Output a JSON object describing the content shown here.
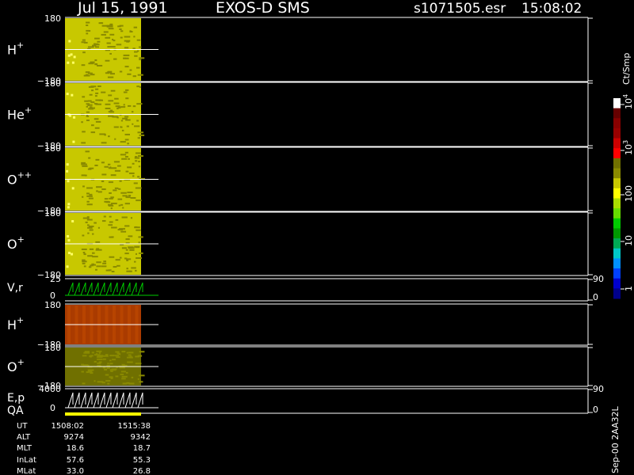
{
  "header": {
    "date": "Jul 15, 1991",
    "instrument": "EXOS-D SMS",
    "file": "s1071505.esr",
    "time": "15:08:02"
  },
  "panels": [
    {
      "id": "h-plus",
      "label": "H",
      "sup": "+",
      "ymax": "180",
      "ymin": "−180",
      "color": "#c8c800"
    },
    {
      "id": "he-plus",
      "label": "He",
      "sup": "+",
      "ymax": "180",
      "ymin": "−180",
      "color": "#c8c800"
    },
    {
      "id": "o-plus-plus",
      "label": "O",
      "sup": "++",
      "ymax": "180",
      "ymin": "−180",
      "color": "#c8c800"
    },
    {
      "id": "o-plus",
      "label": "O",
      "sup": "+",
      "ymax": "180",
      "ymin": "−180",
      "color": "#c8c800"
    },
    {
      "id": "vr",
      "label": "V,r",
      "sup": "",
      "ymax": "25",
      "ymin": "0",
      "rmax": "90",
      "rmin": "0",
      "color": "#00cc00"
    },
    {
      "id": "h-plus-2",
      "label": "H",
      "sup": "+",
      "ymax": "180",
      "ymin": "−180",
      "color": "#cc2200"
    },
    {
      "id": "o-plus-2",
      "label": "O",
      "sup": "+",
      "ymax": "180",
      "ymin": "−180",
      "color": "#707000"
    },
    {
      "id": "ep-qa",
      "label": "E,p",
      "label2": "QA",
      "sup": "",
      "ymax": "4000",
      "ymin": "0",
      "rmax": "90",
      "rmin": "0",
      "color": "#ffffff"
    }
  ],
  "colorbar": {
    "title": "Ct/Smp",
    "ticks": [
      "1",
      "10",
      "100",
      "10",
      "10"
    ],
    "tick_exponents": [
      "",
      "",
      "",
      "3",
      "4"
    ],
    "colors": [
      "#00008b",
      "#0000cd",
      "#0040ff",
      "#0090ff",
      "#00c8c8",
      "#00aa55",
      "#009900",
      "#00cc00",
      "#66dd00",
      "#aadd00",
      "#ffff00",
      "#c8c800",
      "#8a8a00",
      "#707000",
      "#ff0000",
      "#cc0000",
      "#990000",
      "#880000",
      "#660000",
      "#ffffff"
    ]
  },
  "footer": {
    "rows": [
      {
        "label": "UT",
        "v1": "1508:02",
        "v2": "1515:38"
      },
      {
        "label": "ALT",
        "v1": "9274",
        "v2": "9342"
      },
      {
        "label": "MLT",
        "v1": "18.6",
        "v2": "18.7"
      },
      {
        "label": "InLat",
        "v1": "57.6",
        "v2": "55.3"
      },
      {
        "label": "MLat",
        "v1": "33.0",
        "v2": "26.8"
      }
    ],
    "version": "Sep-00 2AA32L"
  },
  "chart_data": {
    "type": "heatmap",
    "title": "Jul 15, 1991   EXOS-D SMS",
    "time_range": [
      "1508:02",
      "1515:38"
    ],
    "series": [
      {
        "name": "H+",
        "yrange": [
          -180,
          180
        ],
        "dominant_level": "100-1000"
      },
      {
        "name": "He+",
        "yrange": [
          -180,
          180
        ],
        "dominant_level": "100-1000"
      },
      {
        "name": "O++",
        "yrange": [
          -180,
          180
        ],
        "dominant_level": "100-1000"
      },
      {
        "name": "O+",
        "yrange": [
          -180,
          180
        ],
        "dominant_level": "100-1000"
      },
      {
        "name": "V,r",
        "yrange": [
          0,
          25
        ],
        "right_range": [
          0,
          90
        ]
      },
      {
        "name": "H+",
        "yrange": [
          -180,
          180
        ],
        "dominant_level": "1000"
      },
      {
        "name": "O+",
        "yrange": [
          -180,
          180
        ],
        "dominant_level": "100-1000"
      },
      {
        "name": "E,p",
        "yrange": [
          0,
          4000
        ],
        "right_range": [
          0,
          90
        ]
      }
    ],
    "colorbar_range": [
      1,
      10000
    ],
    "colorbar_scale": "log"
  }
}
